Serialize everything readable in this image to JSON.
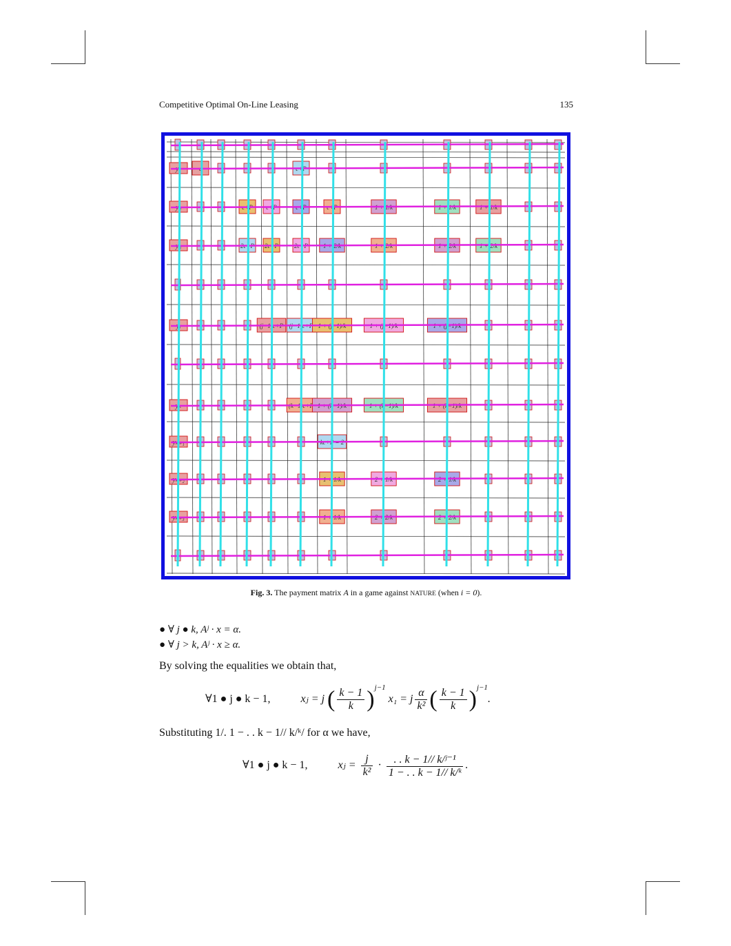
{
  "header": {
    "running_title": "Competitive Optimal On-Line Leasing",
    "page_number": "135"
  },
  "figure": {
    "caption_label": "Fig. 3.",
    "caption_text_1": "The payment matrix",
    "caption_symbol_A": "A",
    "caption_text_2": "in a game against",
    "caption_nature": "NATURE",
    "caption_text_3": "(when",
    "caption_condition": "i = 0",
    "caption_text_4": ").",
    "row_labels": [
      "",
      "y₁",
      "y₂",
      "y₃",
      "",
      "yⱼ",
      "",
      "yₖ",
      "yₖ₊₁",
      "yₖ₊₂",
      "yₖ₊₃",
      ""
    ],
    "cells": {
      "r1c1": "c",
      "r1c5": "c+P",
      "r2c3": "c+P",
      "r2c4": "c+P",
      "r2c5": "c+P",
      "r2c6": "c+P",
      "r2c7": "1 + 1/k",
      "r2c8": "1 + 1/k",
      "r2c9": "1 + 1/k",
      "r3c3": "2c+P",
      "r3c4": "2c+P",
      "r3c5": "2c+P",
      "r3c6": "1 + 2/k",
      "r3c7": "1 + 2/k",
      "r3c8": "1 + 2/k",
      "r3c9": "1 + 2/k",
      "r5c4": "(j−1)c+P",
      "r5c5": "(j−1)c+P",
      "r5c6": "1 + (j−1)/k",
      "r5c7": "1 + (j−1)/k",
      "r5c8": "1 + (j−1)/k",
      "r7c5": "(k−1)c+P",
      "r7c6": "1 + (k−1)/k",
      "r7c7": "1 + (k−1)/k",
      "r7c8": "1 + (k−1)/k",
      "r8c6": "kc+P = 2",
      "r9c6": "1 + 1/k",
      "r9c7": "2 + 1/k",
      "r9c8": "2 + 1/k",
      "r10c6": "1 + 1/k",
      "r10c7": "2 + 2/k",
      "r10c8": "2 + 2/k"
    }
  },
  "bullets": [
    "∀ j ● k, Aʲ · x = α.",
    "∀ j > k, Aʲ · x ≥ α."
  ],
  "paragraph_1": "By solving the equalities we obtain that,",
  "equation_1": {
    "lhs": "∀1 ● j ● k − 1,",
    "xj": "xⱼ = j",
    "num": "k − 1",
    "den": "k",
    "exp": "j−1",
    "mid": "x₁ = j",
    "alpha_num": "α",
    "alpha_den": "k²",
    "num2": "k − 1",
    "den2": "k",
    "exp2": "j−1",
    "end": "."
  },
  "paragraph_2": "Substituting 1/. 1 − . . k − 1// k/ᵏ/ for α we have,",
  "equation_2": {
    "lhs": "∀1 ● j ● k − 1,",
    "xj": "xⱼ =",
    "f1_num": "j",
    "f1_den": "k²",
    "dot": "·",
    "f2_num": ". . k − 1// k/ʲ⁻¹",
    "f2_den": "1 − . . k − 1// k/ᵏ",
    "end": "."
  },
  "colors": {
    "frame_border": "#1010e0",
    "row_lines": "#e020e0",
    "column_lines": "#30e0e8",
    "grid_lines": "#222222"
  }
}
